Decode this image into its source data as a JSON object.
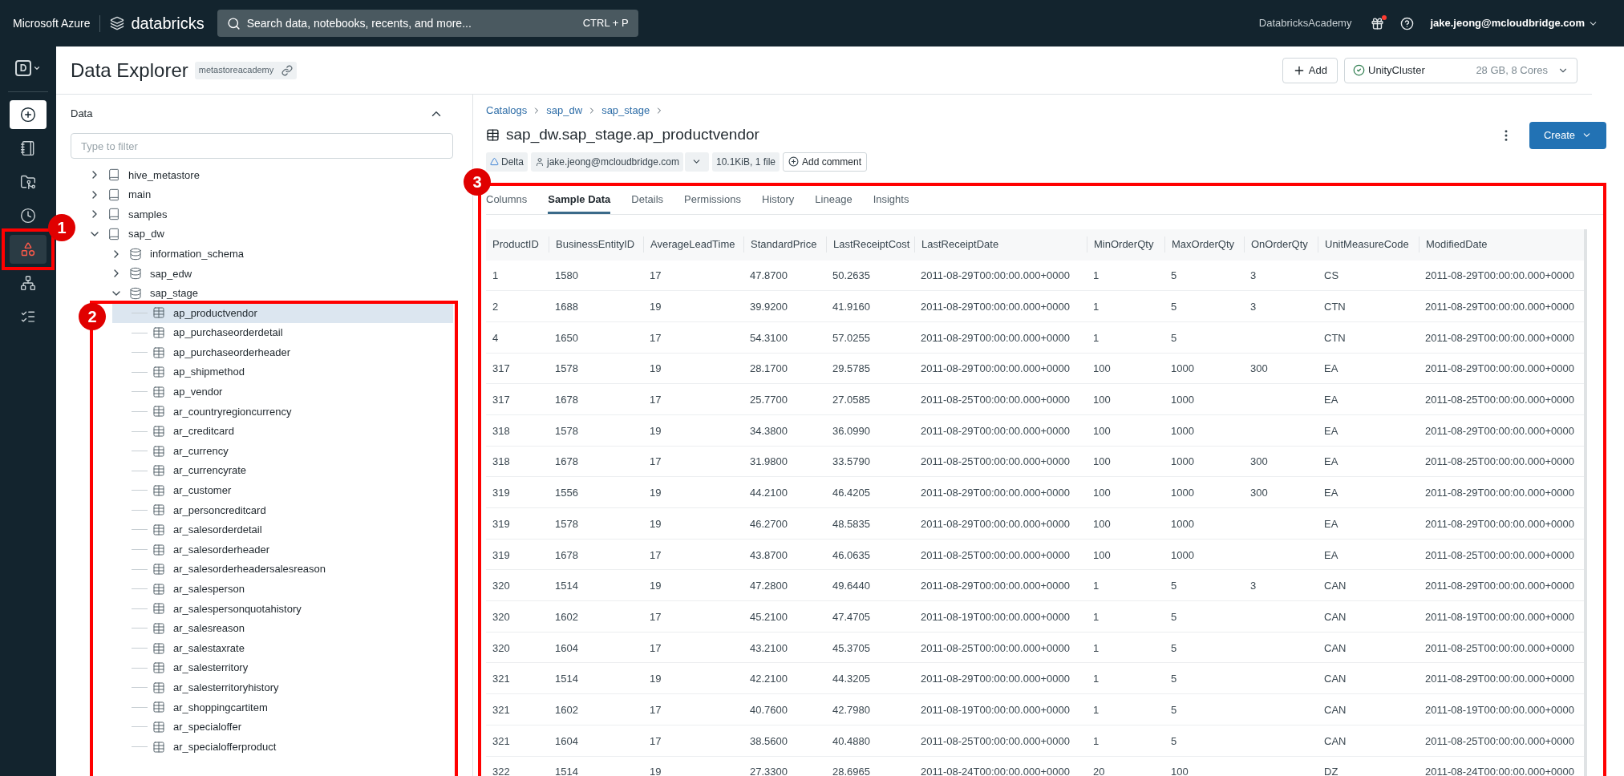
{
  "topbar": {
    "brand": "Microsoft Azure",
    "product": "databricks",
    "search": {
      "placeholder": "Search data, notebooks, recents, and more...",
      "shortcut": "CTRL + P"
    },
    "workspace": "DatabricksAcademy",
    "user": "jake.jeong@mcloudbridge.com"
  },
  "rail": {
    "logo": "D",
    "items": [
      {
        "kind": "new",
        "selected": false
      },
      {
        "kind": "notebook",
        "selected": false
      },
      {
        "kind": "repos",
        "selected": false
      },
      {
        "kind": "recents",
        "selected": false
      },
      {
        "kind": "data",
        "selected": true
      },
      {
        "kind": "compute",
        "selected": false
      },
      {
        "kind": "jobs",
        "selected": false
      }
    ]
  },
  "page": {
    "title": "Data Explorer",
    "metastore": "metastoreacademy",
    "add_button": "Add",
    "cluster": {
      "name": "UnityCluster",
      "spec": "28 GB, 8 Cores"
    }
  },
  "data_panel": {
    "title": "Data",
    "filter": {
      "placeholder": "Type to filter"
    },
    "tree": [
      {
        "label": "hive_metastore",
        "kind": "catalog",
        "expanded": false,
        "selected": false
      },
      {
        "label": "main",
        "kind": "catalog",
        "expanded": false,
        "selected": false
      },
      {
        "label": "samples",
        "kind": "catalog",
        "expanded": false,
        "selected": false
      },
      {
        "label": "sap_dw",
        "kind": "catalog",
        "expanded": true,
        "selected": false,
        "children": [
          {
            "label": "information_schema",
            "kind": "schema",
            "expanded": false,
            "selected": false
          },
          {
            "label": "sap_edw",
            "kind": "schema",
            "expanded": false,
            "selected": false
          },
          {
            "label": "sap_stage",
            "kind": "schema",
            "expanded": true,
            "selected": false,
            "children": [
              {
                "label": "ap_productvendor",
                "kind": "table",
                "selected": true
              },
              {
                "label": "ap_purchaseorderdetail",
                "kind": "table",
                "selected": false
              },
              {
                "label": "ap_purchaseorderheader",
                "kind": "table",
                "selected": false
              },
              {
                "label": "ap_shipmethod",
                "kind": "table",
                "selected": false
              },
              {
                "label": "ap_vendor",
                "kind": "table",
                "selected": false
              },
              {
                "label": "ar_countryregioncurrency",
                "kind": "table",
                "selected": false
              },
              {
                "label": "ar_creditcard",
                "kind": "table",
                "selected": false
              },
              {
                "label": "ar_currency",
                "kind": "table",
                "selected": false
              },
              {
                "label": "ar_currencyrate",
                "kind": "table",
                "selected": false
              },
              {
                "label": "ar_customer",
                "kind": "table",
                "selected": false
              },
              {
                "label": "ar_personcreditcard",
                "kind": "table",
                "selected": false
              },
              {
                "label": "ar_salesorderdetail",
                "kind": "table",
                "selected": false
              },
              {
                "label": "ar_salesorderheader",
                "kind": "table",
                "selected": false
              },
              {
                "label": "ar_salesorderheadersalesreason",
                "kind": "table",
                "selected": false
              },
              {
                "label": "ar_salesperson",
                "kind": "table",
                "selected": false
              },
              {
                "label": "ar_salespersonquotahistory",
                "kind": "table",
                "selected": false
              },
              {
                "label": "ar_salesreason",
                "kind": "table",
                "selected": false
              },
              {
                "label": "ar_salestaxrate",
                "kind": "table",
                "selected": false
              },
              {
                "label": "ar_salesterritory",
                "kind": "table",
                "selected": false
              },
              {
                "label": "ar_salesterritoryhistory",
                "kind": "table",
                "selected": false
              },
              {
                "label": "ar_shoppingcartitem",
                "kind": "table",
                "selected": false
              },
              {
                "label": "ar_specialoffer",
                "kind": "table",
                "selected": false
              },
              {
                "label": "ar_specialofferproduct",
                "kind": "table",
                "selected": false
              }
            ]
          }
        ]
      }
    ]
  },
  "detail": {
    "breadcrumbs": [
      "Catalogs",
      "sap_dw",
      "sap_stage"
    ],
    "title": "sap_dw.sap_stage.ap_productvendor",
    "create_button": "Create",
    "chips": [
      {
        "kind": "format",
        "label": "Delta"
      },
      {
        "kind": "owner",
        "label": "jake.jeong@mcloudbridge.com"
      },
      {
        "kind": "size",
        "label": "10.1KiB, 1 file"
      },
      {
        "kind": "comment",
        "label": "Add comment"
      }
    ],
    "tabs": [
      {
        "label": "Columns",
        "selected": false
      },
      {
        "label": "Sample Data",
        "selected": true
      },
      {
        "label": "Details",
        "selected": false
      },
      {
        "label": "Permissions",
        "selected": false
      },
      {
        "label": "History",
        "selected": false
      },
      {
        "label": "Lineage",
        "selected": false
      },
      {
        "label": "Insights",
        "selected": false
      }
    ],
    "table": {
      "columns": [
        "ProductID",
        "BusinessEntityID",
        "AverageLeadTime",
        "StandardPrice",
        "LastReceiptCost",
        "LastReceiptDate",
        "MinOrderQty",
        "MaxOrderQty",
        "OnOrderQty",
        "UnitMeasureCode",
        "ModifiedDate"
      ],
      "rows": [
        [
          "1",
          "1580",
          "17",
          "47.8700",
          "50.2635",
          "2011-08-29T00:00:00.000+0000",
          "1",
          "5",
          "3",
          "CS",
          "2011-08-29T00:00:00.000+0000"
        ],
        [
          "2",
          "1688",
          "19",
          "39.9200",
          "41.9160",
          "2011-08-29T00:00:00.000+0000",
          "1",
          "5",
          "3",
          "CTN",
          "2011-08-29T00:00:00.000+0000"
        ],
        [
          "4",
          "1650",
          "17",
          "54.3100",
          "57.0255",
          "2011-08-29T00:00:00.000+0000",
          "1",
          "5",
          null,
          "CTN",
          "2011-08-29T00:00:00.000+0000"
        ],
        [
          "317",
          "1578",
          "19",
          "28.1700",
          "29.5785",
          "2011-08-29T00:00:00.000+0000",
          "100",
          "1000",
          "300",
          "EA",
          "2011-08-29T00:00:00.000+0000"
        ],
        [
          "317",
          "1678",
          "17",
          "25.7700",
          "27.0585",
          "2011-08-25T00:00:00.000+0000",
          "100",
          "1000",
          null,
          "EA",
          "2011-08-25T00:00:00.000+0000"
        ],
        [
          "318",
          "1578",
          "19",
          "34.3800",
          "36.0990",
          "2011-08-29T00:00:00.000+0000",
          "100",
          "1000",
          null,
          "EA",
          "2011-08-29T00:00:00.000+0000"
        ],
        [
          "318",
          "1678",
          "17",
          "31.9800",
          "33.5790",
          "2011-08-25T00:00:00.000+0000",
          "100",
          "1000",
          "300",
          "EA",
          "2011-08-25T00:00:00.000+0000"
        ],
        [
          "319",
          "1556",
          "19",
          "44.2100",
          "46.4205",
          "2011-08-29T00:00:00.000+0000",
          "100",
          "1000",
          "300",
          "EA",
          "2011-08-29T00:00:00.000+0000"
        ],
        [
          "319",
          "1578",
          "19",
          "46.2700",
          "48.5835",
          "2011-08-29T00:00:00.000+0000",
          "100",
          "1000",
          null,
          "EA",
          "2011-08-29T00:00:00.000+0000"
        ],
        [
          "319",
          "1678",
          "17",
          "43.8700",
          "46.0635",
          "2011-08-25T00:00:00.000+0000",
          "100",
          "1000",
          null,
          "EA",
          "2011-08-25T00:00:00.000+0000"
        ],
        [
          "320",
          "1514",
          "19",
          "47.2800",
          "49.6440",
          "2011-08-29T00:00:00.000+0000",
          "1",
          "5",
          "3",
          "CAN",
          "2011-08-29T00:00:00.000+0000"
        ],
        [
          "320",
          "1602",
          "17",
          "45.2100",
          "47.4705",
          "2011-08-19T00:00:00.000+0000",
          "1",
          "5",
          null,
          "CAN",
          "2011-08-19T00:00:00.000+0000"
        ],
        [
          "320",
          "1604",
          "17",
          "43.2100",
          "45.3705",
          "2011-08-25T00:00:00.000+0000",
          "1",
          "5",
          null,
          "CAN",
          "2011-08-25T00:00:00.000+0000"
        ],
        [
          "321",
          "1514",
          "19",
          "42.2100",
          "44.3205",
          "2011-08-29T00:00:00.000+0000",
          "1",
          "5",
          null,
          "CAN",
          "2011-08-29T00:00:00.000+0000"
        ],
        [
          "321",
          "1602",
          "17",
          "40.7600",
          "42.7980",
          "2011-08-19T00:00:00.000+0000",
          "1",
          "5",
          null,
          "CAN",
          "2011-08-19T00:00:00.000+0000"
        ],
        [
          "321",
          "1604",
          "17",
          "38.5600",
          "40.4880",
          "2011-08-25T00:00:00.000+0000",
          "1",
          "5",
          null,
          "CAN",
          "2011-08-25T00:00:00.000+0000"
        ],
        [
          "322",
          "1514",
          "19",
          "27.3300",
          "28.6965",
          "2011-08-24T00:00:00.000+0000",
          "20",
          "100",
          null,
          "DZ",
          "2011-08-24T00:00:00.000+0000"
        ]
      ]
    }
  },
  "annotations": [
    {
      "label": "1"
    },
    {
      "label": "2"
    },
    {
      "label": "3"
    }
  ]
}
